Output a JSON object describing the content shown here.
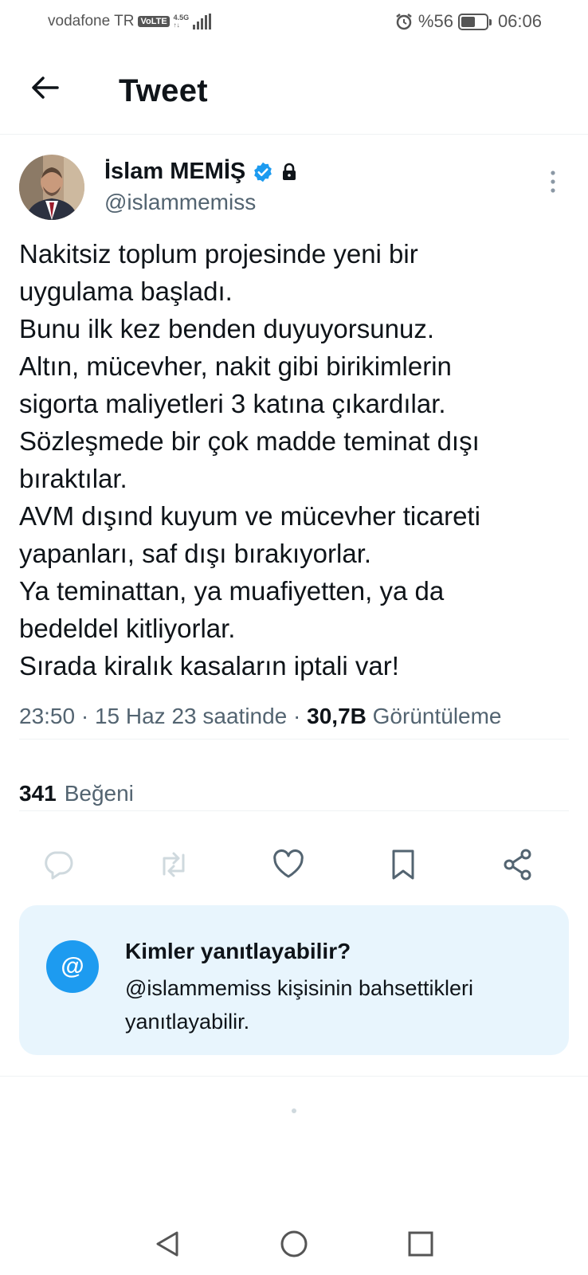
{
  "status_bar": {
    "carrier": "vodafone TR",
    "volte": "VoLTE",
    "network": "4.5G",
    "battery_text": "%56",
    "battery_level": 0.56,
    "time": "06:06"
  },
  "header": {
    "title": "Tweet"
  },
  "tweet": {
    "author_name": "İslam MEMİŞ",
    "handle": "@islammemiss",
    "lines": [
      "Nakitsiz toplum projesinde yeni bir",
      "uygulama başladı.",
      "Bunu ilk kez benden duyuyorsunuz.",
      "Altın, mücevher, nakit gibi birikimlerin",
      "sigorta maliyetleri 3 katına çıkardılar.",
      "Sözleşmede bir çok madde teminat dışı",
      "bıraktılar.",
      "AVM dışınd kuyum ve mücevher ticareti",
      "yapanları, saf dışı bırakıyorlar.",
      "Ya teminattan, ya muafiyetten, ya da",
      "bedeldel kitliyorlar.",
      "Sırada kiralık kasaların iptali var!"
    ],
    "time": "23:50",
    "date": "15 Haz 23 saatinde",
    "views_count": "30,7B",
    "views_label": "Görüntüleme",
    "likes_count": "341",
    "likes_label": "Beğeni"
  },
  "reply_restriction": {
    "title": "Kimler yanıtlayabilir?",
    "description": "@islammemiss kişisinin bahsettikleri yanıtlayabilir.",
    "icon_symbol": "@"
  },
  "colors": {
    "accent": "#1d9bf0",
    "text_primary": "#0f1419",
    "text_secondary": "#536471",
    "card_bg": "#e8f5fd",
    "disabled_icon": "#cfd9de"
  },
  "icons": {
    "back": "arrow-left-icon",
    "verified": "verified-badge-icon",
    "protected": "lock-icon",
    "more": "more-vertical-icon",
    "reply": "reply-icon",
    "retweet": "retweet-icon",
    "like": "heart-icon",
    "bookmark": "bookmark-icon",
    "share": "share-icon"
  }
}
